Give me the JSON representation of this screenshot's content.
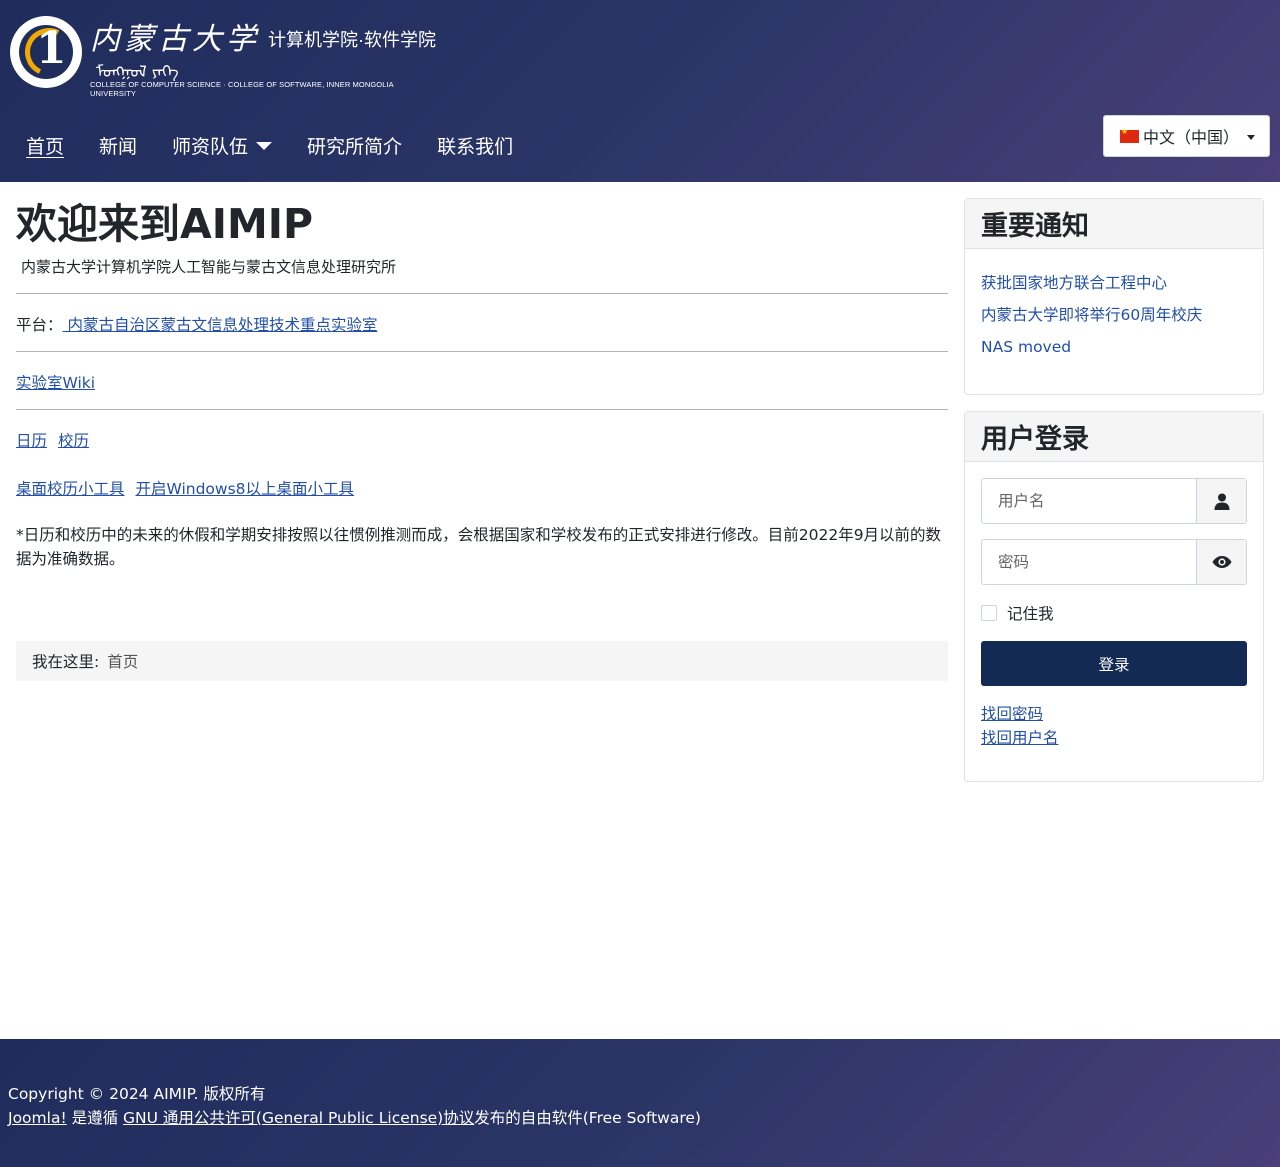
{
  "header": {
    "logo": {
      "calligraphy": "内蒙古大学",
      "college": "计算机学院·软件学院",
      "mongolian": "ᠮᠣᠩᠭᠣᠯ ᠶᠡᠬᠡ",
      "english": "COLLEGE OF COMPUTER SCIENCE · COLLEGE OF SOFTWARE, INNER MONGOLIA UNIVERSITY"
    },
    "nav": [
      {
        "label": "首页",
        "active": true
      },
      {
        "label": "新闻"
      },
      {
        "label": "师资队伍",
        "dropdown": true
      },
      {
        "label": "研究所简介"
      },
      {
        "label": "联系我们"
      }
    ],
    "language": {
      "selected": "中文（中国）",
      "flag": "cn-flag-icon"
    }
  },
  "main": {
    "title": "欢迎来到AIMIP",
    "subtitle": "内蒙古大学计算机学院人工智能与蒙古文信息处理研究所",
    "platform_label": "平台：",
    "platform_link": " 内蒙古自治区蒙古文信息处理技术重点实验室",
    "wiki_link": "实验室Wiki",
    "calendar_link": "日历",
    "school_calendar_link": "校历",
    "desktop_tool_link": "桌面校历小工具",
    "windows_tool_link": "开启Windows8以上桌面小工具",
    "note": "*日历和校历中的未来的休假和学期安排按照以往惯例推测而成，会根据国家和学校发布的正式安排进行修改。目前2022年9月以前的数据为准确数据。"
  },
  "breadcrumb": {
    "label": "我在这里:",
    "current": "首页"
  },
  "notices": {
    "title": "重要通知",
    "items": [
      "获批国家地方联合工程中心",
      "内蒙古大学即将举行60周年校庆",
      "NAS moved"
    ]
  },
  "login": {
    "title": "用户登录",
    "username_placeholder": "用户名",
    "password_placeholder": "密码",
    "remember_label": "记住我",
    "submit_label": "登录",
    "forgot_password": "找回密码",
    "forgot_username": "找回用户名"
  },
  "footer": {
    "copyright": "Copyright © 2024 AIMIP. 版权所有",
    "joomla_link": "Joomla!",
    "joomla_text": " 是遵循 ",
    "gpl_link": "GNU 通用公共许可(General Public License)协议",
    "gpl_text": "发布的自由软件(Free Software)"
  },
  "colors": {
    "header_gradient_start": "#1f2c5c",
    "header_gradient_end": "#4a3f78",
    "link": "#224faa",
    "login_button": "#132a55"
  }
}
